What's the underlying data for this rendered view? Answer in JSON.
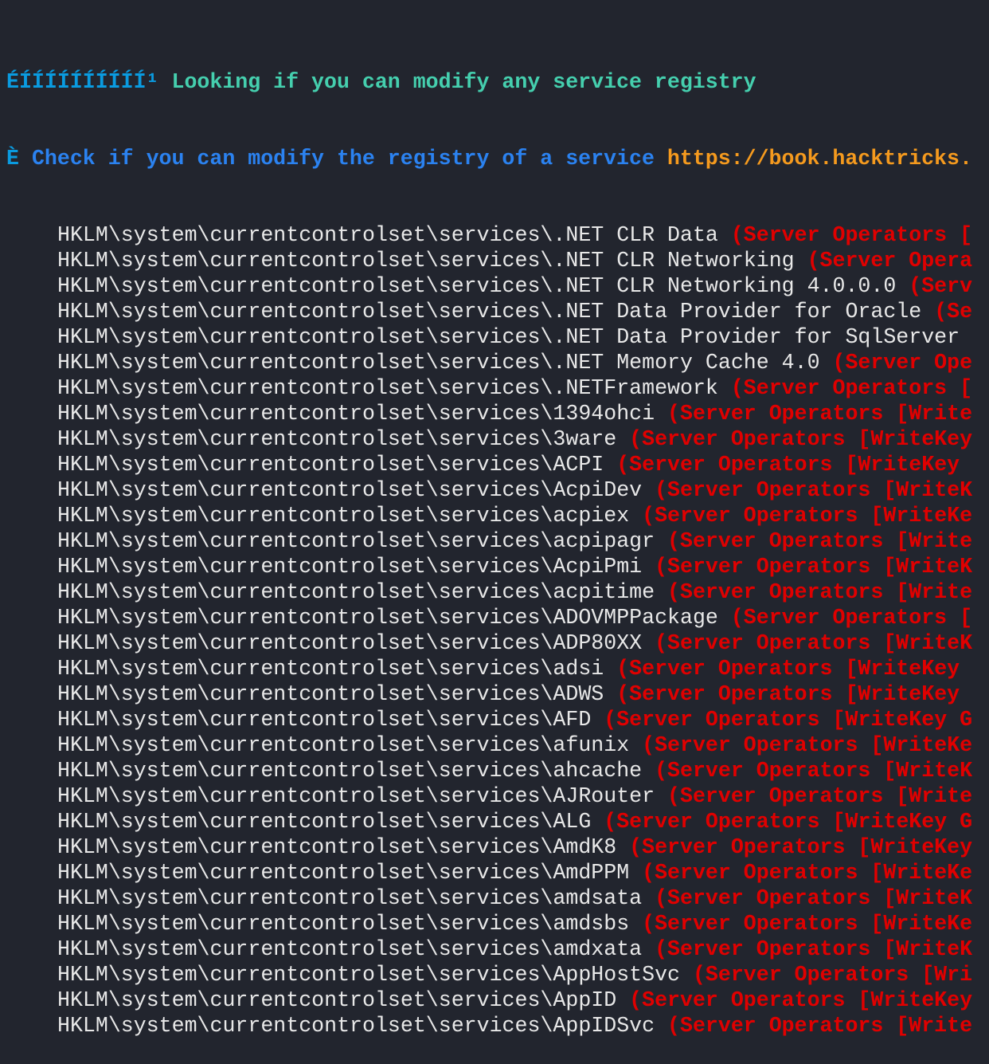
{
  "header": {
    "bar_glyphs": "ÉÍÍÍÍÍÍÍÍÍÍ¹",
    "title": "Looking if you can modify any service registry",
    "check_glyph": "È",
    "check_text": "Check if you can modify the registry of a service",
    "link": "https://book.hacktricks."
  },
  "prefix": "HKLM\\system\\currentcontrolset\\services\\",
  "entries": [
    {
      "name": ".NET CLR Data",
      "perm": "(Server Operators ["
    },
    {
      "name": ".NET CLR Networking",
      "perm": "(Server Opera"
    },
    {
      "name": ".NET CLR Networking 4.0.0.0",
      "perm": "(Serv"
    },
    {
      "name": ".NET Data Provider for Oracle",
      "perm": "(Se"
    },
    {
      "name": ".NET Data Provider for SqlServer",
      "perm": ""
    },
    {
      "name": ".NET Memory Cache 4.0",
      "perm": "(Server Ope"
    },
    {
      "name": ".NETFramework",
      "perm": "(Server Operators ["
    },
    {
      "name": "1394ohci",
      "perm": "(Server Operators [Write"
    },
    {
      "name": "3ware",
      "perm": "(Server Operators [WriteKey"
    },
    {
      "name": "ACPI",
      "perm": "(Server Operators [WriteKey"
    },
    {
      "name": "AcpiDev",
      "perm": "(Server Operators [WriteK"
    },
    {
      "name": "acpiex",
      "perm": "(Server Operators [WriteKe"
    },
    {
      "name": "acpipagr",
      "perm": "(Server Operators [Write"
    },
    {
      "name": "AcpiPmi",
      "perm": "(Server Operators [WriteK"
    },
    {
      "name": "acpitime",
      "perm": "(Server Operators [Write"
    },
    {
      "name": "ADOVMPPackage",
      "perm": "(Server Operators ["
    },
    {
      "name": "ADP80XX",
      "perm": "(Server Operators [WriteK"
    },
    {
      "name": "adsi",
      "perm": "(Server Operators [WriteKey"
    },
    {
      "name": "ADWS",
      "perm": "(Server Operators [WriteKey"
    },
    {
      "name": "AFD",
      "perm": "(Server Operators [WriteKey G"
    },
    {
      "name": "afunix",
      "perm": "(Server Operators [WriteKe"
    },
    {
      "name": "ahcache",
      "perm": "(Server Operators [WriteK"
    },
    {
      "name": "AJRouter",
      "perm": "(Server Operators [Write"
    },
    {
      "name": "ALG",
      "perm": "(Server Operators [WriteKey G"
    },
    {
      "name": "AmdK8",
      "perm": "(Server Operators [WriteKey"
    },
    {
      "name": "AmdPPM",
      "perm": "(Server Operators [WriteKe"
    },
    {
      "name": "amdsata",
      "perm": "(Server Operators [WriteK"
    },
    {
      "name": "amdsbs",
      "perm": "(Server Operators [WriteKe"
    },
    {
      "name": "amdxata",
      "perm": "(Server Operators [WriteK"
    },
    {
      "name": "AppHostSvc",
      "perm": "(Server Operators [Wri"
    },
    {
      "name": "AppID",
      "perm": "(Server Operators [WriteKey"
    },
    {
      "name": "AppIDSvc",
      "perm": "(Server Operators [Write"
    }
  ]
}
